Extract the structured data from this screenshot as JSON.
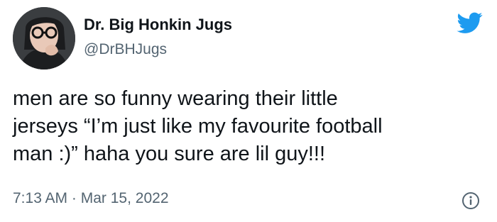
{
  "author": {
    "display_name": "Dr. Big Honkin Jugs",
    "handle": "@DrBHJugs"
  },
  "tweet": {
    "lines": [
      "men are so funny wearing their little",
      "jerseys “I’m just like my favourite football",
      "man :)” haha you sure are lil guy!!!"
    ]
  },
  "meta": {
    "time": "7:13 AM",
    "separator": "·",
    "date": "Mar 15, 2022"
  },
  "icons": {
    "brand": "twitter-bird-icon",
    "info": "info-icon"
  },
  "colors": {
    "brand": "#1d9bf0",
    "text": "#0f1419",
    "secondary": "#536471"
  }
}
